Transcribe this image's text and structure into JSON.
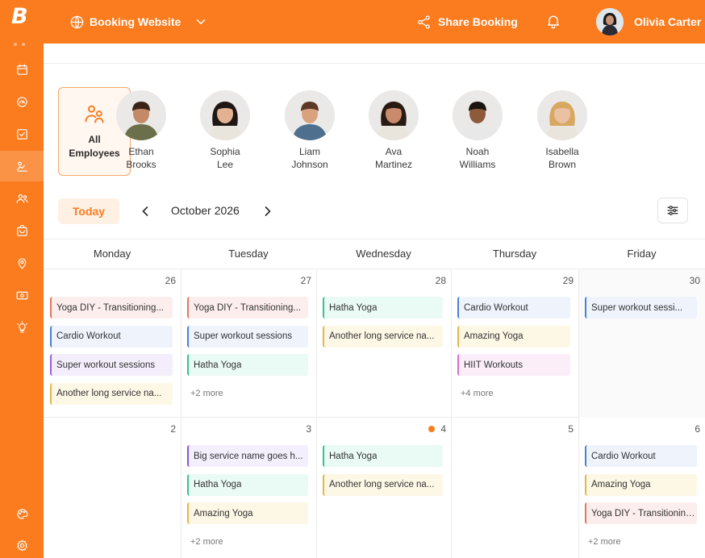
{
  "brand": {
    "logo_letter": "B",
    "accent": "#fb7c1f"
  },
  "topbar": {
    "site_label": "Booking Website",
    "share_label": "Share Booking",
    "user_name": "Olivia Carter"
  },
  "sidebar": {
    "items": [
      {
        "icon": "calendar-icon"
      },
      {
        "icon": "dashboard-icon"
      },
      {
        "icon": "checklist-icon"
      },
      {
        "icon": "services-icon",
        "active": true
      },
      {
        "icon": "users-icon"
      },
      {
        "icon": "store-icon"
      },
      {
        "icon": "location-icon"
      },
      {
        "icon": "payments-icon"
      },
      {
        "icon": "ideas-icon"
      },
      {
        "icon": "palette-icon"
      },
      {
        "icon": "settings-icon"
      }
    ]
  },
  "employees": {
    "all_label": "All Employees",
    "list": [
      {
        "first": "Ethan",
        "last": "Brooks"
      },
      {
        "first": "Sophia",
        "last": "Lee"
      },
      {
        "first": "Liam",
        "last": "Johnson"
      },
      {
        "first": "Ava",
        "last": "Martinez"
      },
      {
        "first": "Noah",
        "last": "Williams"
      },
      {
        "first": "Isabella",
        "last": "Brown"
      }
    ]
  },
  "toolbar": {
    "today_label": "Today",
    "month_label": "October 2026"
  },
  "calendar": {
    "day_headers": [
      "Monday",
      "Tuesday",
      "Wednesday",
      "Thursday",
      "Friday"
    ],
    "weeks": [
      {
        "days": [
          {
            "date": "26",
            "events": [
              {
                "title": "Yoga DIY - Transitioning...",
                "color": "red"
              },
              {
                "title": "Cardio Workout",
                "color": "blue"
              },
              {
                "title": "Super workout sessions",
                "color": "purple"
              },
              {
                "title": "Another long service na...",
                "color": "yellow"
              }
            ],
            "more": ""
          },
          {
            "date": "27",
            "events": [
              {
                "title": "Yoga DIY - Transitioning...",
                "color": "red"
              },
              {
                "title": "Super workout sessions",
                "color": "blue"
              },
              {
                "title": "Hatha Yoga",
                "color": "green"
              }
            ],
            "more": "+2 more"
          },
          {
            "date": "28",
            "events": [
              {
                "title": "Hatha Yoga",
                "color": "green"
              },
              {
                "title": "Another long service na...",
                "color": "yellow"
              }
            ],
            "more": ""
          },
          {
            "date": "29",
            "events": [
              {
                "title": "Cardio Workout",
                "color": "blue"
              },
              {
                "title": "Amazing Yoga",
                "color": "yellow"
              },
              {
                "title": "HIIT Workouts",
                "color": "pink"
              }
            ],
            "more": "+4 more"
          },
          {
            "date": "30",
            "events": [
              {
                "title": "Super workout sessi...",
                "color": "blue"
              }
            ],
            "more": "",
            "shaded": true
          }
        ]
      },
      {
        "days": [
          {
            "date": "2",
            "events": [],
            "more": ""
          },
          {
            "date": "3",
            "events": [
              {
                "title": "Big service name goes h...",
                "color": "violet"
              },
              {
                "title": "Hatha Yoga",
                "color": "green"
              },
              {
                "title": "Amazing Yoga",
                "color": "yellow"
              }
            ],
            "more": "+2 more"
          },
          {
            "date": "4",
            "dot": true,
            "events": [
              {
                "title": "Hatha Yoga",
                "color": "green"
              },
              {
                "title": "Another long service na...",
                "color": "yellow"
              }
            ],
            "more": ""
          },
          {
            "date": "5",
            "events": [],
            "more": ""
          },
          {
            "date": "6",
            "events": [
              {
                "title": "Cardio Workout",
                "color": "blue"
              },
              {
                "title": "Amazing Yoga",
                "color": "yellow"
              },
              {
                "title": "Yoga DIY - Transitioning...",
                "color": "red"
              }
            ],
            "more": "+2 more"
          }
        ]
      }
    ]
  }
}
